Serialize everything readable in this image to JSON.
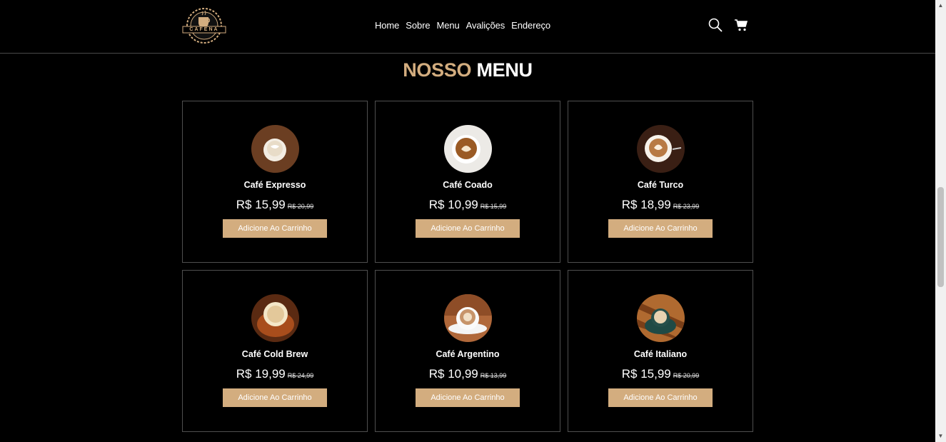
{
  "brand": {
    "name": "CAFENA",
    "accent_color": "#d3ad7f"
  },
  "nav": {
    "items": [
      "Home",
      "Sobre",
      "Menu",
      "Avalições",
      "Endereço"
    ]
  },
  "header_icons": [
    "search-icon",
    "cart-icon"
  ],
  "section": {
    "title_accent": "NOSSO",
    "title_rest": "MENU"
  },
  "menu": {
    "items": [
      {
        "name": "Café Expresso",
        "price": "R$ 15,99",
        "old_price": "R$ 20,99",
        "button": "Adicione Ao Carrinho"
      },
      {
        "name": "Café Coado",
        "price": "R$ 10,99",
        "old_price": "R$ 15,99",
        "button": "Adicione Ao Carrinho"
      },
      {
        "name": "Café Turco",
        "price": "R$ 18,99",
        "old_price": "R$ 23,99",
        "button": "Adicione Ao Carrinho"
      },
      {
        "name": "Café Cold Brew",
        "price": "R$ 19,99",
        "old_price": "R$ 24,99",
        "button": "Adicione Ao Carrinho"
      },
      {
        "name": "Café Argentino",
        "price": "R$ 10,99",
        "old_price": "R$ 13,99",
        "button": "Adicione Ao Carrinho"
      },
      {
        "name": "Café Italiano",
        "price": "R$ 15,99",
        "old_price": "R$ 20,99",
        "button": "Adicione Ao Carrinho"
      }
    ]
  }
}
